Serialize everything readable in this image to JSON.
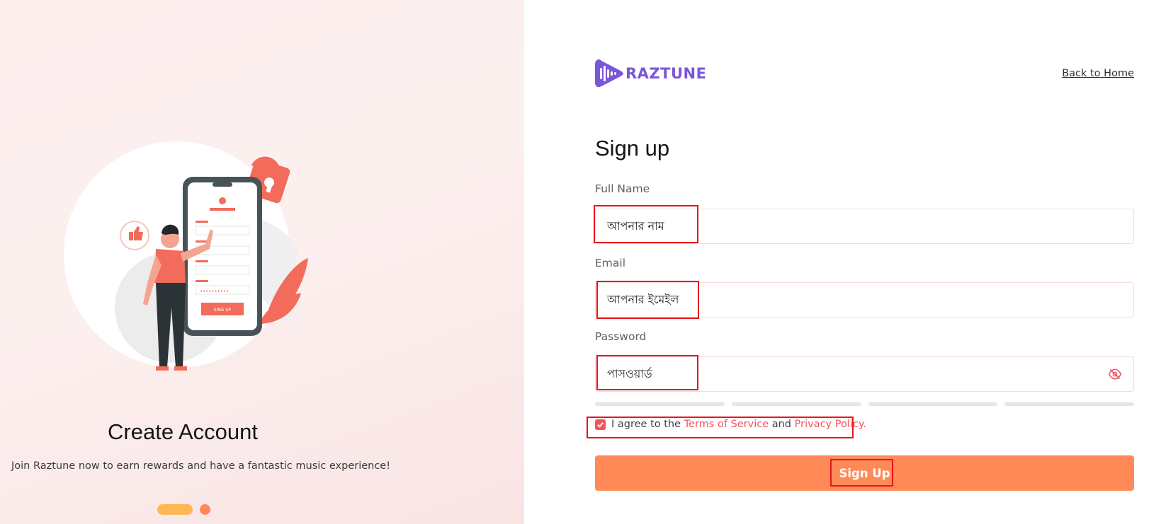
{
  "promo": {
    "title": "Create Account",
    "subtitle": "Join Raztune now to earn rewards and have a fantastic music experience!",
    "phone_button_label": "SING UP",
    "slides": {
      "count": 2,
      "active": 1
    }
  },
  "brand": {
    "name": "RAZTUNE",
    "color": "#7b56d8",
    "accent": "#ff8a58",
    "link_color": "#f2545b"
  },
  "header": {
    "back_link": "Back to Home"
  },
  "form": {
    "title": "Sign up",
    "full_name": {
      "label": "Full Name",
      "placeholder": "আপনার নাম"
    },
    "email": {
      "label": "Email",
      "placeholder": "আপনার ইমেইল"
    },
    "password": {
      "label": "Password",
      "placeholder": "পাসওয়ার্ড",
      "toggle_icon": "eye-off-icon"
    },
    "strength_segments": 4,
    "agree": {
      "checked": true,
      "prefix": "I agree to the",
      "terms": "Terms of Service",
      "conjunction": "and",
      "privacy": "Privacy Policy."
    },
    "submit_label": "Sign Up"
  }
}
